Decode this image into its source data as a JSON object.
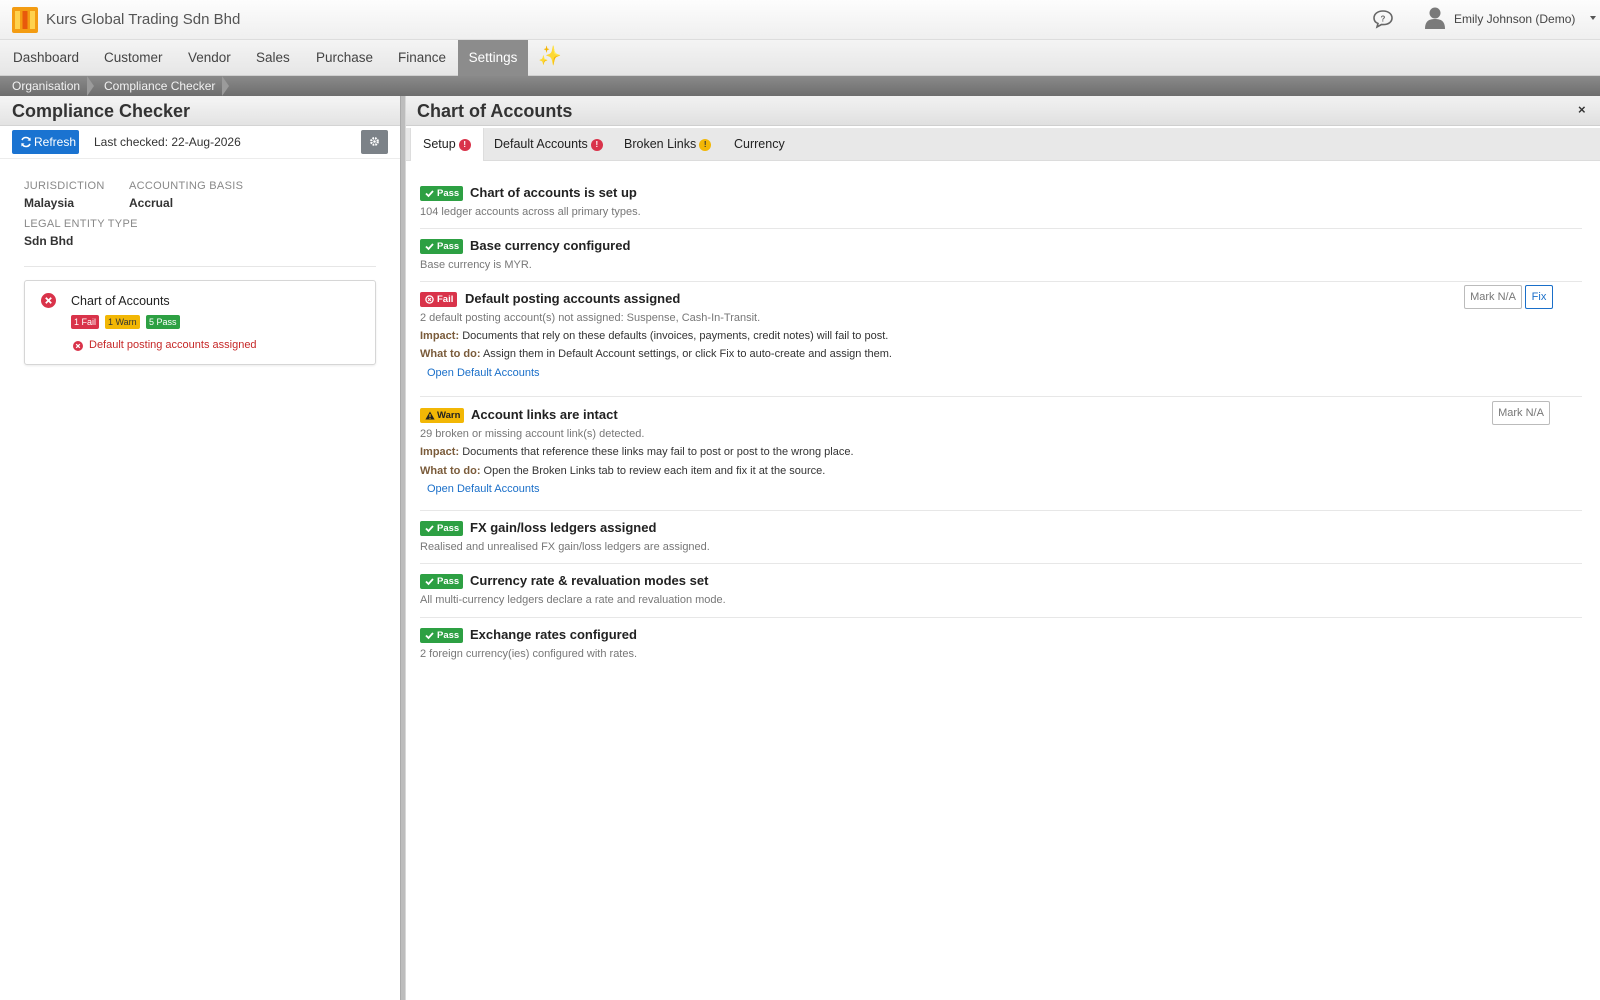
{
  "app": {
    "title": "Kurs Global Trading Sdn Bhd",
    "user": "Emily Johnson (Demo)"
  },
  "nav": {
    "items": [
      "Dashboard",
      "Customer",
      "Vendor",
      "Sales",
      "Purchase",
      "Finance",
      "Settings"
    ],
    "active": "Settings",
    "sparkle": "✨"
  },
  "breadcrumb": [
    "Organisation",
    "Compliance Checker"
  ],
  "left": {
    "title": "Compliance Checker",
    "refresh_label": "Refresh",
    "last_checked": "Last checked: 22-Aug-2026",
    "meta": {
      "jurisdiction_label": "JURISDICTION",
      "jurisdiction": "Malaysia",
      "basis_label": "ACCOUNTING BASIS",
      "basis": "Accrual",
      "entity_label": "LEGAL ENTITY TYPE",
      "entity": "Sdn Bhd"
    },
    "card": {
      "title": "Chart of Accounts",
      "fail": "1 Fail",
      "warn": "1 Warn",
      "pass": "5 Pass",
      "issue": "Default posting accounts assigned"
    }
  },
  "right": {
    "title": "Chart of Accounts",
    "close": "×",
    "tabs": [
      {
        "label": "Setup",
        "dot": "!"
      },
      {
        "label": "Default Accounts",
        "dot": "!"
      },
      {
        "label": "Broken Links",
        "dot": "!"
      },
      {
        "label": "Currency"
      }
    ],
    "checks": [
      {
        "status": "Pass",
        "title": "Chart of accounts is set up",
        "desc": "104 ledger accounts across all primary types."
      },
      {
        "status": "Pass",
        "title": "Base currency configured",
        "desc": "Base currency is MYR."
      },
      {
        "status": "Fail",
        "title": "Default posting accounts assigned",
        "desc": "2 default posting account(s) not assigned: Suspense, Cash-In-Transit.",
        "impact_label": "Impact:",
        "impact": "Documents that rely on these defaults (invoices, payments, credit notes) will fail to post.",
        "todo_label": "What to do:",
        "todo": "Assign them in Default Account settings, or click Fix to auto-create and assign them.",
        "link": "Open Default Accounts",
        "mark_na": "Mark N/A",
        "fix": "Fix"
      },
      {
        "status": "Warn",
        "title": "Account links are intact",
        "desc": "29 broken or missing account link(s) detected.",
        "impact_label": "Impact:",
        "impact": "Documents that reference these links may fail to post or post to the wrong place.",
        "todo_label": "What to do:",
        "todo": "Open the Broken Links tab to review each item and fix it at the source.",
        "link": "Open Default Accounts",
        "mark_na": "Mark N/A"
      },
      {
        "status": "Pass",
        "title": "FX gain/loss ledgers assigned",
        "desc": "Realised and unrealised FX gain/loss ledgers are assigned."
      },
      {
        "status": "Pass",
        "title": "Currency rate & revaluation modes set",
        "desc": "All multi-currency ledgers declare a rate and revaluation mode."
      },
      {
        "status": "Pass",
        "title": "Exchange rates configured",
        "desc": "2 foreign currency(ies) configured with rates."
      }
    ]
  },
  "colors": {
    "pass": "#2da043",
    "fail": "#d9334a",
    "warn": "#f2b705",
    "primary": "#1a73d1",
    "nav_active": "#8c8c8c"
  }
}
